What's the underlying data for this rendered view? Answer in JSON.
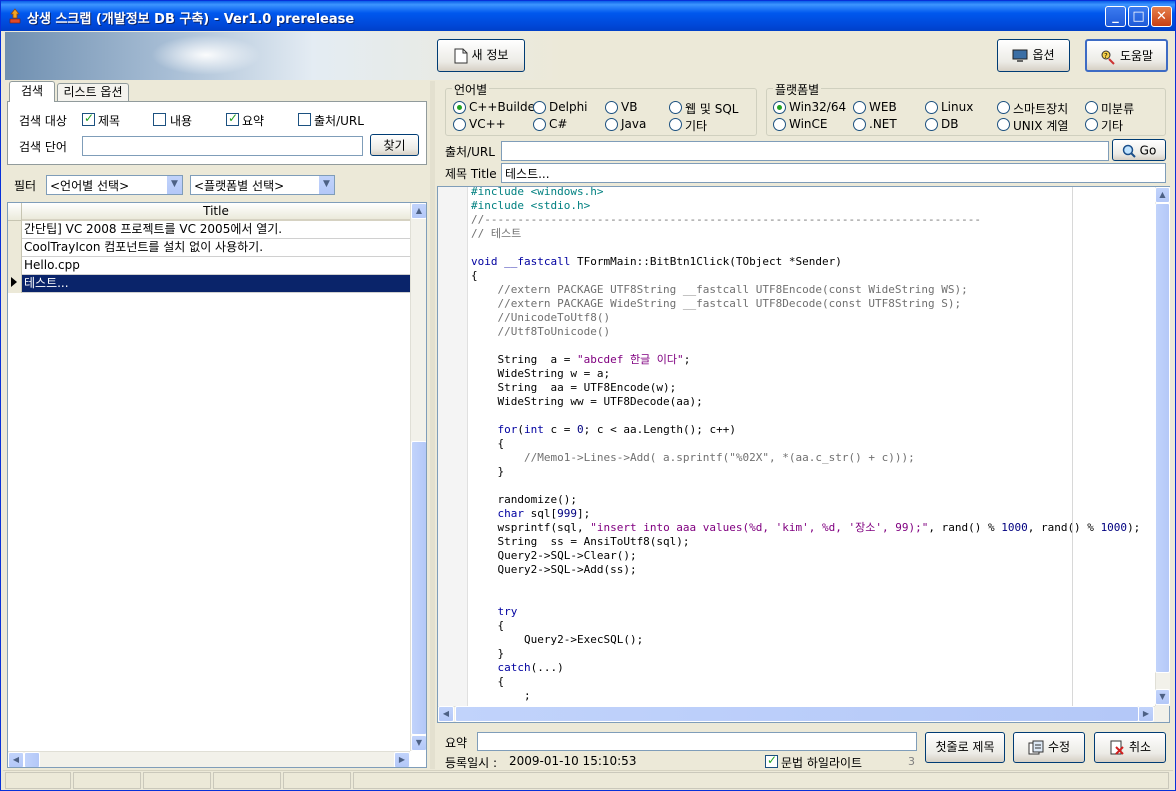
{
  "window": {
    "title": "상생 스크랩 (개발정보 DB 구축) - Ver1.0 prerelease"
  },
  "toolbar": {
    "new_label": "새 정보",
    "options_label": "옵션",
    "help_label": "도움말"
  },
  "search": {
    "tabs": [
      "검색",
      "리스트 옵션"
    ],
    "target_label": "검색 대상",
    "targets": [
      {
        "label": "제목",
        "checked": true
      },
      {
        "label": "내용",
        "checked": false
      },
      {
        "label": "요약",
        "checked": true
      },
      {
        "label": "출처/URL",
        "checked": false
      }
    ],
    "keyword_label": "검색 단어",
    "keyword_value": "",
    "find_label": "찾기"
  },
  "filter": {
    "label": "필터",
    "language": "<언어별 선택>",
    "platform": "<플랫폼별 선택>"
  },
  "list": {
    "column": "Title",
    "rows": [
      {
        "title": "간단팁] VC 2008 프로젝트를 VC 2005에서 열기.",
        "selected": false
      },
      {
        "title": "CoolTrayIcon 컴포넌트를 설치 없이 사용하기.",
        "selected": false
      },
      {
        "title": "Hello.cpp",
        "selected": false
      },
      {
        "title": "테스트...",
        "selected": true
      }
    ]
  },
  "language_group": {
    "title": "언어별",
    "options": [
      {
        "label": "C++Builder",
        "selected": true
      },
      {
        "label": "Delphi",
        "selected": false
      },
      {
        "label": "VB",
        "selected": false
      },
      {
        "label": "웹 및 SQL",
        "selected": false
      },
      {
        "label": "VC++",
        "selected": false
      },
      {
        "label": "C#",
        "selected": false
      },
      {
        "label": "Java",
        "selected": false
      },
      {
        "label": "기타",
        "selected": false
      }
    ]
  },
  "platform_group": {
    "title": "플랫폼별",
    "options": [
      {
        "label": "Win32/64",
        "selected": true
      },
      {
        "label": "WEB",
        "selected": false
      },
      {
        "label": "Linux",
        "selected": false
      },
      {
        "label": "스마트장치",
        "selected": false
      },
      {
        "label": "미분류",
        "selected": false
      },
      {
        "label": "WinCE",
        "selected": false
      },
      {
        "label": ".NET",
        "selected": false
      },
      {
        "label": "DB",
        "selected": false
      },
      {
        "label": "UNIX 계열",
        "selected": false
      },
      {
        "label": "기타",
        "selected": false
      }
    ]
  },
  "source": {
    "label": "출처/URL",
    "value": "",
    "go_label": "Go"
  },
  "title_field": {
    "label": "제목 Title",
    "value": "테스트..."
  },
  "summary": {
    "label": "요약",
    "value": ""
  },
  "footer": {
    "reg_label": "등록일시 :",
    "reg_value": "2009-01-10 15:10:53",
    "highlight_label": "문법 하일라이트",
    "highlight_checked": true,
    "count": "3",
    "first_line_label": "첫줄로 제목",
    "edit_label": "수정",
    "cancel_label": "취소"
  },
  "editor": {
    "lines": [
      "#include <windows.h>",
      "#include <stdio.h>",
      "//---------------------------------------------------------------------------",
      "// 테스트",
      "",
      "void __fastcall TFormMain::BitBtn1Click(TObject *Sender)",
      "{",
      "    //extern PACKAGE UTF8String __fastcall UTF8Encode(const WideString WS);",
      "    //extern PACKAGE WideString __fastcall UTF8Decode(const UTF8String S);",
      "    //UnicodeToUtf8()",
      "    //Utf8ToUnicode()",
      "",
      "    String  a = \"abcdef 한글 이다\";",
      "    WideString w = a;",
      "    String  aa = UTF8Encode(w);",
      "    WideString ww = UTF8Decode(aa);",
      "",
      "    for(int c = 0; c < aa.Length(); c++)",
      "    {",
      "        //Memo1->Lines->Add( a.sprintf(\"%02X\", *(aa.c_str() + c)));",
      "    }",
      "",
      "    randomize();",
      "    char sql[999];",
      "    wsprintf(sql, \"insert into aaa values(%d, 'kim', %d, '장소', 99);\", rand() % 1000, rand() % 1000);",
      "    String  ss = AnsiToUtf8(sql);",
      "    Query2->SQL->Clear();",
      "    Query2->SQL->Add(ss);",
      "",
      "",
      "    try",
      "    {",
      "        Query2->ExecSQL();",
      "    }",
      "    catch(...)",
      "    {",
      "        ;"
    ]
  }
}
